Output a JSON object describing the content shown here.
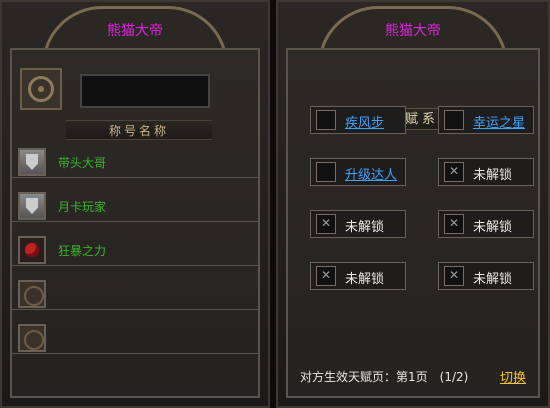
{
  "left_panel": {
    "char_name": "熊猫大帝",
    "section_title": "称号名称",
    "titles": [
      {
        "label": "带头大哥",
        "icon": "shield-icon"
      },
      {
        "label": "月卡玩家",
        "icon": "shield-icon"
      },
      {
        "label": "狂暴之力",
        "icon": "rose-icon"
      },
      {
        "label": "",
        "icon": "empty-slot-icon"
      },
      {
        "label": "",
        "icon": "empty-slot-icon"
      }
    ]
  },
  "right_panel": {
    "char_name": "熊猫大帝",
    "header": "天赋系统",
    "talents": [
      {
        "label": "疾风步",
        "state": "unlocked",
        "icon": "flame-icon"
      },
      {
        "label": "幸运之星",
        "state": "unlocked",
        "icon": "star-icon"
      },
      {
        "label": "升级达人",
        "state": "unlocked",
        "icon": "levelup-icon"
      },
      {
        "label": "未解锁",
        "state": "locked",
        "icon": "lock-icon"
      },
      {
        "label": "未解锁",
        "state": "locked",
        "icon": "lock-icon"
      },
      {
        "label": "未解锁",
        "state": "locked",
        "icon": "lock-icon"
      },
      {
        "label": "未解锁",
        "state": "locked",
        "icon": "lock-icon"
      },
      {
        "label": "未解锁",
        "state": "locked",
        "icon": "lock-icon"
      }
    ],
    "footer": {
      "info_text": "对方生效天赋页：第1页　(1/2)",
      "switch_label": "切换"
    }
  },
  "colors": {
    "name": "#e020e0",
    "title_text": "#39b52a",
    "unlocked": "#3ea2ff",
    "switch": "#f2c233"
  }
}
